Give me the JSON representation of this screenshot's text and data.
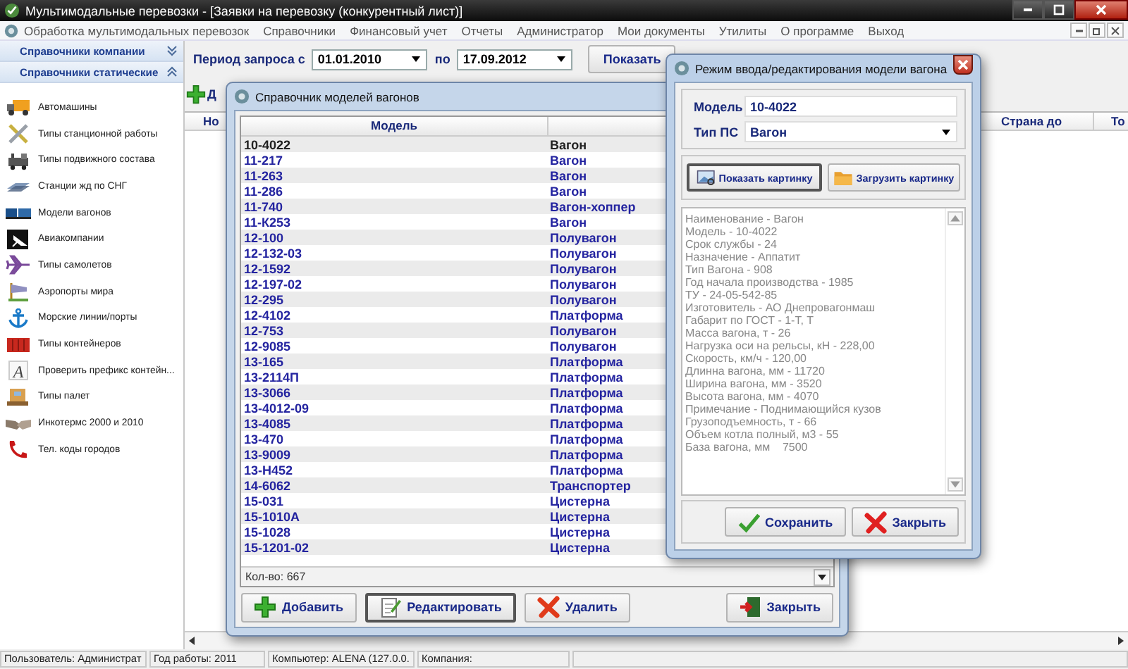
{
  "window": {
    "title": "Мультимодальные перевозки - [Заявки на перевозку (конкурентный лист)]",
    "menu": [
      "Обработка мультимодальных перевозок",
      "Справочники",
      "Финансовый учет",
      "Отчеты",
      "Администратор",
      "Мои документы",
      "Утилиты",
      "О программе",
      "Выход"
    ]
  },
  "sidebar": {
    "groups": [
      {
        "label": "Справочники компании",
        "expanded": false
      },
      {
        "label": "Справочники статические",
        "expanded": true
      }
    ],
    "items": [
      {
        "label": "Автомашины",
        "kind": "truck"
      },
      {
        "label": "Типы станционной работы",
        "kind": "tools"
      },
      {
        "label": "Типы подвижного состава",
        "kind": "locomotive"
      },
      {
        "label": "Станции жд по СНГ",
        "kind": "rails"
      },
      {
        "label": "Модели вагонов",
        "kind": "train"
      },
      {
        "label": "Авиакомпании",
        "kind": "airline"
      },
      {
        "label": "Типы самолетов",
        "kind": "plane"
      },
      {
        "label": "Аэропорты мира",
        "kind": "windsock"
      },
      {
        "label": "Морские линии/порты",
        "kind": "anchor"
      },
      {
        "label": "Типы контейнеров",
        "kind": "container"
      },
      {
        "label": "Проверить префикс контейн...",
        "kind": "letter",
        "glyph": "A"
      },
      {
        "label": "Типы палет",
        "kind": "box"
      },
      {
        "label": "Инкотермс 2000 и 2010",
        "kind": "handshake"
      },
      {
        "label": "Тел. коды городов",
        "kind": "phone"
      }
    ]
  },
  "filter": {
    "from_label": "Период запроса с",
    "from": "01.01.2010",
    "to_label": "по",
    "to": "17.09.2012",
    "button": "Показать"
  },
  "background_grid": {
    "toolbar_label": "Д",
    "columns": [
      "Но",
      "Страна до",
      "То"
    ]
  },
  "models_dialog": {
    "title": "Справочник моделей вагонов",
    "column_1": "Модель",
    "rows": [
      {
        "model": "10-4022",
        "type": "Вагон",
        "selected": true
      },
      {
        "model": "11-217",
        "type": "Вагон",
        "selected": false
      },
      {
        "model": "11-263",
        "type": "Вагон",
        "selected": false
      },
      {
        "model": "11-286",
        "type": "Вагон",
        "selected": false
      },
      {
        "model": "11-740",
        "type": "Вагон-хоппер",
        "selected": false
      },
      {
        "model": "11-К253",
        "type": "Вагон",
        "selected": false
      },
      {
        "model": "12-100",
        "type": "Полувагон",
        "selected": false
      },
      {
        "model": "12-132-03",
        "type": "Полувагон",
        "selected": false
      },
      {
        "model": "12-1592",
        "type": "Полувагон",
        "selected": false
      },
      {
        "model": "12-197-02",
        "type": "Полувагон",
        "selected": false
      },
      {
        "model": "12-295",
        "type": "Полувагон",
        "selected": false
      },
      {
        "model": "12-4102",
        "type": "Платформа",
        "selected": false
      },
      {
        "model": "12-753",
        "type": "Полувагон",
        "selected": false
      },
      {
        "model": "12-9085",
        "type": "Полувагон",
        "selected": false
      },
      {
        "model": "13-165",
        "type": "Платформа",
        "selected": false
      },
      {
        "model": "13-2114П",
        "type": "Платформа",
        "selected": false
      },
      {
        "model": "13-3066",
        "type": "Платформа",
        "selected": false
      },
      {
        "model": "13-4012-09",
        "type": "Платформа",
        "selected": false
      },
      {
        "model": "13-4085",
        "type": "Платформа",
        "selected": false
      },
      {
        "model": "13-470",
        "type": "Платформа",
        "selected": false
      },
      {
        "model": "13-9009",
        "type": "Платформа",
        "selected": false
      },
      {
        "model": "13-Н452",
        "type": "Платформа",
        "selected": false
      },
      {
        "model": "14-6062",
        "type": "Транспортер",
        "selected": false
      },
      {
        "model": "15-031",
        "type": "Цистерна",
        "selected": false
      },
      {
        "model": "15-1010А",
        "type": "Цистерна",
        "selected": false
      },
      {
        "model": "15-1028",
        "type": "Цистерна",
        "selected": false
      },
      {
        "model": "15-1201-02",
        "type": "Цистерна",
        "selected": false
      }
    ],
    "count": "Кол-во: 667",
    "buttons": [
      {
        "label": "Добавить",
        "kind": "add",
        "focused": false
      },
      {
        "label": "Редактировать",
        "kind": "edit",
        "focused": true
      },
      {
        "label": "Удалить",
        "kind": "delete",
        "focused": false
      }
    ],
    "close_button": "Закрыть"
  },
  "edit_dialog": {
    "title": "Режим ввода/редактирования модели вагона",
    "model_label": "Модель",
    "model": "10-4022",
    "type_label": "Тип ПС",
    "type": "Вагон",
    "picture_buttons": [
      {
        "label": "Показать картинку",
        "kind": "show",
        "focused": true
      },
      {
        "label": "Загрузить картинку",
        "kind": "load",
        "focused": false
      }
    ],
    "details": [
      "Наименование - Вагон",
      "Модель - 10-4022",
      "Срок службы - 24",
      "Назначение - Аппатит",
      "Тип Вагона - 908",
      "Год начала производства - 1985",
      "ТУ - 24-05-542-85",
      "Изготовитель - АО Днепровагонмаш",
      "Габарит по ГОСТ - 1-Т, Т",
      "Масса вагона, т - 26",
      "Нагрузка оси на рельсы, кН - 228,00",
      "Скорость, км/ч - 120,00",
      "Длинна вагона, мм - 11720",
      "Ширина вагона, мм - 3520",
      "Высота вагона, мм - 4070",
      "Примечание - Поднимающийся кузов",
      "Грузоподъемность, т - 66",
      "Объем котла полный, м3 - 55",
      "База вагона, мм    7500"
    ],
    "buttons": [
      {
        "label": "Сохранить",
        "kind": "save"
      },
      {
        "label": "Закрыть",
        "kind": "close"
      }
    ]
  },
  "status_bar": [
    "Пользователь: Администрат",
    "Год работы: 2011",
    "Компьютер: ALENA (127.0.0.",
    "Компания:"
  ]
}
